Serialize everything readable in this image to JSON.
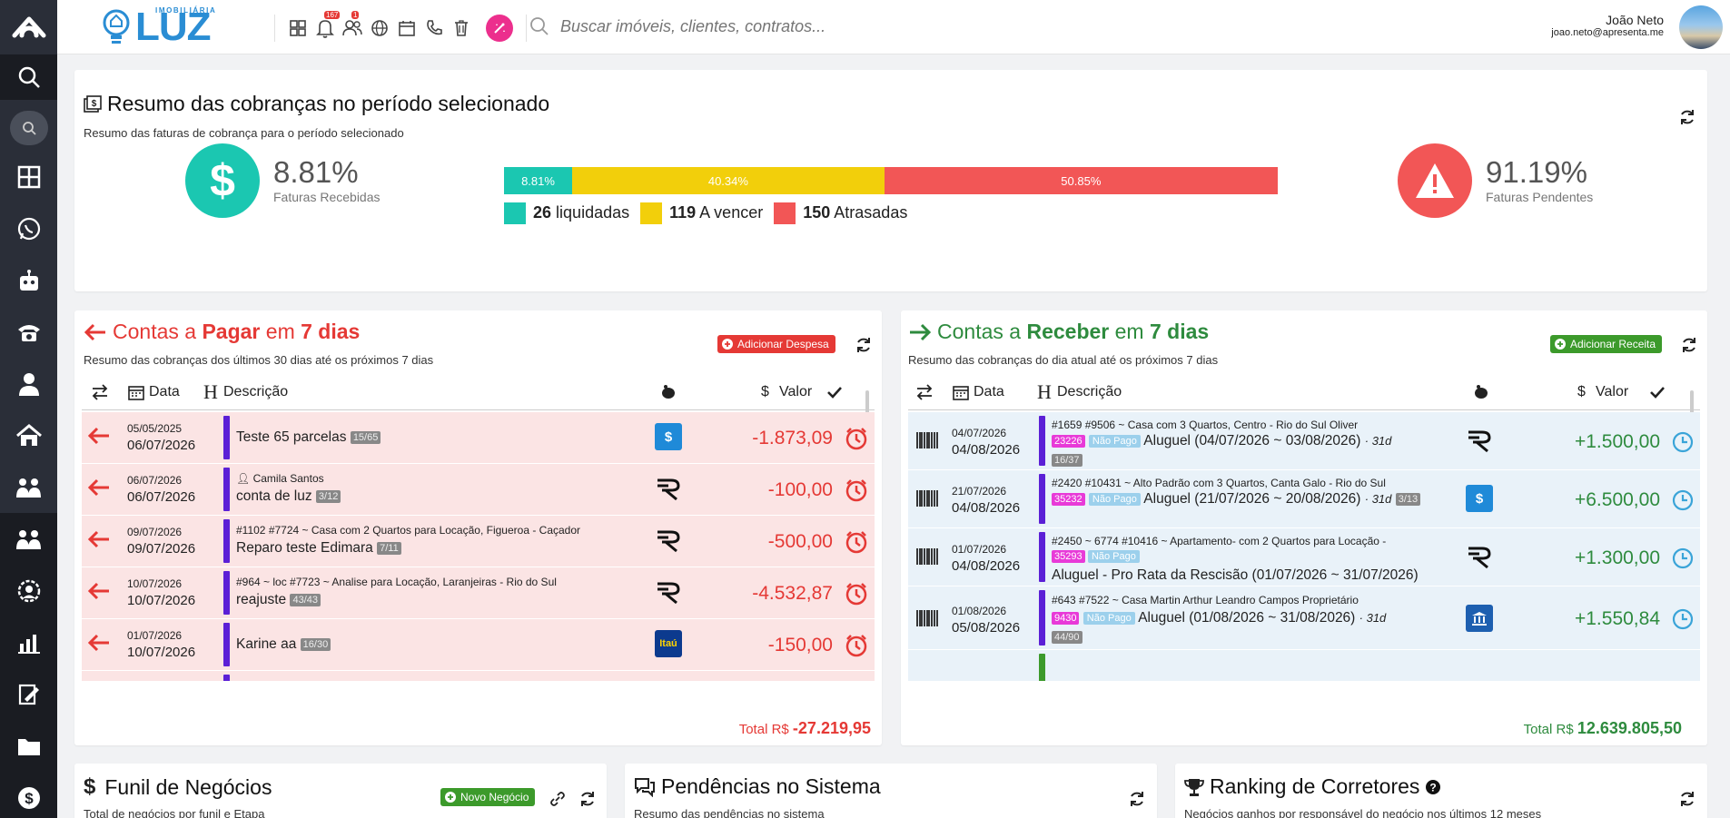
{
  "brand": {
    "small": "IMOBILIÁRIA",
    "big": "LUZ"
  },
  "topbar": {
    "badge_notifications": "167",
    "badge_users": "1",
    "search_placeholder": "Buscar imóveis, clientes, contratos...",
    "user_name": "João Neto",
    "user_email": "joao.neto@apresenta.me"
  },
  "resumo": {
    "title": "Resumo das cobranças no período selecionado",
    "subtitle": "Resumo das faturas de cobrança para o período selecionado",
    "recebidas_pct": "8.81%",
    "recebidas_label": "Faturas Recebidas",
    "pendentes_pct": "91.19%",
    "pendentes_label": "Faturas Pendentes",
    "bar": [
      {
        "label": "8.81%",
        "value": 8.81,
        "color": "#1bc7b1"
      },
      {
        "label": "40.34%",
        "value": 40.34,
        "color": "#f2cf0b"
      },
      {
        "label": "50.85%",
        "value": 50.85,
        "color": "#f25656"
      }
    ],
    "legend": [
      {
        "count": "26",
        "label": "liquidadas",
        "color": "#1bc7b1"
      },
      {
        "count": "119",
        "label": "A vencer",
        "color": "#f2cf0b"
      },
      {
        "count": "150",
        "label": "Atrasadas",
        "color": "#f25656"
      }
    ]
  },
  "pagar": {
    "title_pre": "Contas a ",
    "title_bold": "Pagar",
    "title_mid": " em ",
    "title_days": "7 dias",
    "subtitle": "Resumo das cobranças dos últimos 30 dias até os próximos 7 dias",
    "add_label": "Adicionar Despesa",
    "col_data": "Data",
    "col_desc": "Descrição",
    "col_valor": "Valor",
    "total_label": "Total R$",
    "total_value": "-27.219,95",
    "rows": [
      {
        "d1": "05/05/2025",
        "d2": "06/07/2026",
        "line1": "",
        "desc": "Teste 65 parcelas",
        "tag": "15/65",
        "value": "-1.873,09",
        "bank": "money"
      },
      {
        "d1": "06/07/2026",
        "d2": "06/07/2026",
        "line1": "Camila Santos",
        "desc": "conta de luz",
        "tag": "3/12",
        "value": "-100,00",
        "bank": "r"
      },
      {
        "d1": "09/07/2026",
        "d2": "09/07/2026",
        "line1": "#1102  #7724 ~ Casa com 2 Quartos para Locação, Figueroa - Caçador",
        "desc": "Reparo teste Edimara",
        "tag": "7/11",
        "value": "-500,00",
        "bank": "r"
      },
      {
        "d1": "10/07/2026",
        "d2": "10/07/2026",
        "line1": "#964 ~ loc  #7723 ~ Analise para Locação, Laranjeiras - Rio do Sul",
        "desc": "reajuste",
        "tag": "43/43",
        "value": "-4.532,87",
        "bank": "r"
      },
      {
        "d1": "01/07/2026",
        "d2": "10/07/2026",
        "line1": "",
        "desc": "Karine aa",
        "tag": "16/30",
        "value": "-150,00",
        "bank": "itau"
      }
    ]
  },
  "receber": {
    "title_pre": "Contas a ",
    "title_bold": "Receber",
    "title_mid": " em ",
    "title_days": "7 dias",
    "subtitle": "Resumo das cobranças do dia atual até os próximos 7 dias",
    "add_label": "Adicionar Receita",
    "col_data": "Data",
    "col_desc": "Descrição",
    "col_valor": "Valor",
    "total_label": "Total R$",
    "total_value": "12.639.805,50",
    "rows": [
      {
        "d1": "04/07/2026",
        "d2": "04/08/2026",
        "line1": "#1659  #9506 ~ Casa com 3 Quartos, Centro - Rio do Sul  Oliver",
        "code": "23226",
        "status": "Não Pago",
        "desc": "Aluguel (04/07/2026 ~ 03/08/2026)",
        "days": "· 31d",
        "tag": "16/37",
        "value": "+1.500,00",
        "bank": "r"
      },
      {
        "d1": "21/07/2026",
        "d2": "04/08/2026",
        "line1": "#2420  #10431 ~ Alto Padrão com 3 Quartos, Canta Galo - Rio do Sul",
        "code": "35232",
        "status": "Não Pago",
        "desc": "Aluguel (21/07/2026 ~ 20/08/2026)",
        "days": "· 31d",
        "tag": "3/13",
        "value": "+6.500,00",
        "bank": "money"
      },
      {
        "d1": "01/07/2026",
        "d2": "04/08/2026",
        "line1": "#2450 ~ 6774  #10416 ~ Apartamento- com 2 Quartos para Locação -",
        "code": "35293",
        "status": "Não Pago",
        "desc": "Aluguel - Pro Rata da Rescisão (01/07/2026 ~ 31/07/2026)",
        "days": "",
        "tag": "",
        "value": "+1.300,00",
        "bank": "r"
      },
      {
        "d1": "01/08/2026",
        "d2": "05/08/2026",
        "line1": "#643  #7522 ~ Casa  Martin Arthur Leandro Campos  Proprietário",
        "code": "9430",
        "status": "Não Pago",
        "desc": "Aluguel (01/08/2026 ~ 31/08/2026)",
        "days": "· 31d",
        "tag": "44/90",
        "value": "+1.550,84",
        "bank": "bank"
      }
    ]
  },
  "funil": {
    "title": "Funil de Negócios",
    "subtitle": "Total de negócios por funil e Etapa",
    "btn": "Novo Negócio"
  },
  "pendencias": {
    "title": "Pendências no Sistema",
    "subtitle": "Resumo das pendências no sistema"
  },
  "ranking": {
    "title": "Ranking de Corretores",
    "subtitle": "Negócios ganhos por responsável do negócio nos últimos 12 meses"
  }
}
